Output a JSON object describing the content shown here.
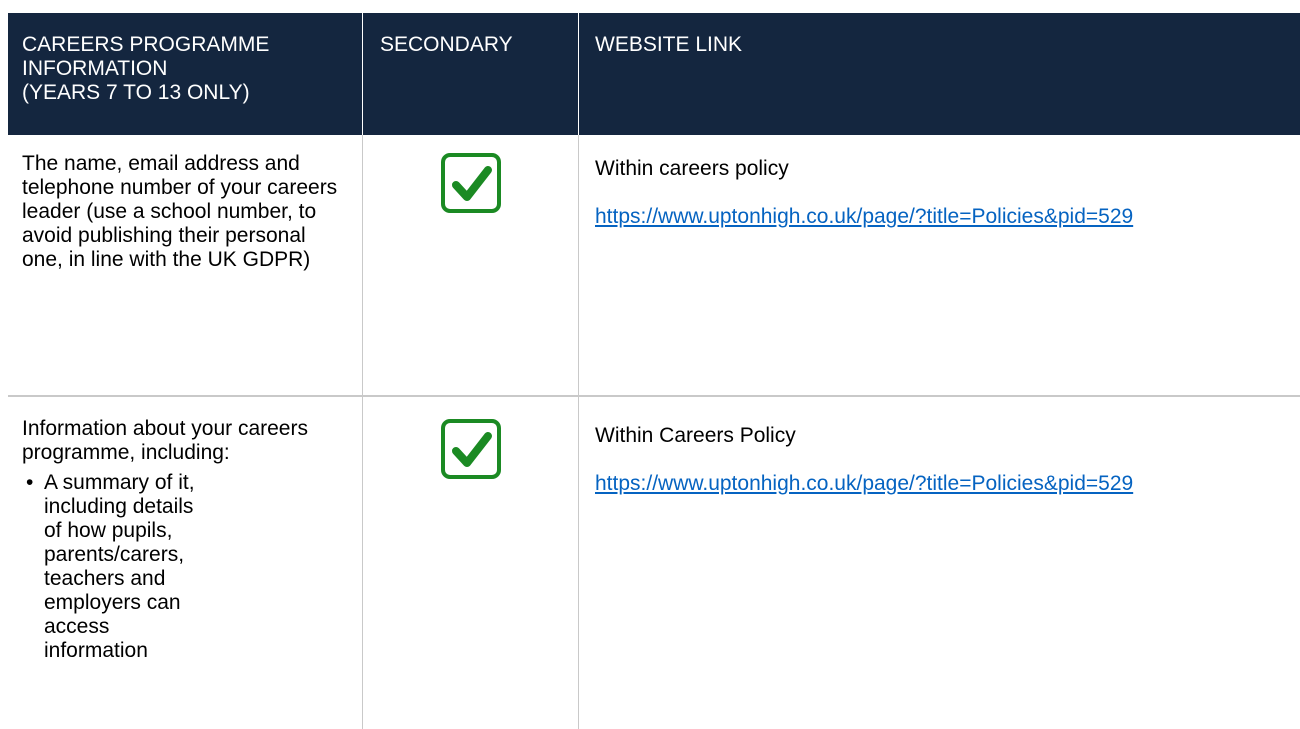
{
  "header": {
    "col1_line1": "CAREERS PROGRAMME",
    "col1_line2": "INFORMATION",
    "col1_line3": "(YEARS 7 TO 13 ONLY)",
    "col2": "SECONDARY",
    "col3": "WEBSITE LINK"
  },
  "rows": [
    {
      "info": "The name, email address and telephone number of your careers leader (use a school number, to avoid publishing their personal one, in line with the UK GDPR)",
      "secondary_checked": true,
      "website_note": "Within careers policy",
      "website_url": "https://www.uptonhigh.co.uk/page/?title=Policies&pid=529"
    },
    {
      "info": "Information about your careers programme, including:",
      "bullets": [
        "A summary of it, including details of how pupils, parents/carers, teachers and employers can access information"
      ],
      "secondary_checked": true,
      "website_note": "Within Careers Policy",
      "website_url": "https://www.uptonhigh.co.uk/page/?title=Policies&pid=529"
    }
  ],
  "colors": {
    "header_bg": "#14263f",
    "check_green": "#1b8a23",
    "link_blue": "#0563c1"
  },
  "icons": {
    "check": "checkbox-checked-icon",
    "bullet": "bullet-icon"
  }
}
